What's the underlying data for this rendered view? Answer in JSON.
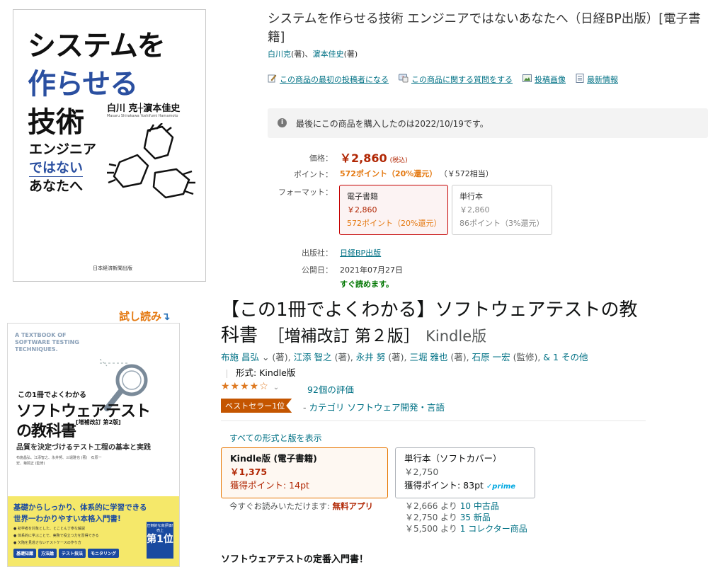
{
  "book1": {
    "cover": {
      "line1": "システムを",
      "line2a": "作らせる",
      "line3": "技術",
      "authors": "白川 克┼濵本佳史",
      "romaji": "Masaru Shirakawa    Yoshifumi Hamamoto",
      "sub1": "エンジニア",
      "sub2": "ではない",
      "sub3": "あなたへ",
      "publisher": "日本経済新聞出版"
    },
    "title": "システムを作らせる技術 エンジニアではないあなたへ（日経BP出版）[電子書籍]",
    "author1": "白川克",
    "author1_role": "(著)、",
    "author2": "濵本佳史",
    "author2_role": "(著)",
    "actions": [
      {
        "label": "この商品の最初の投稿者になる",
        "icon": "pencil-icon"
      },
      {
        "label": "この商品に関する質問をする",
        "icon": "question-icon"
      },
      {
        "label": "投稿画像",
        "icon": "image-icon"
      },
      {
        "label": "最新情報",
        "icon": "document-icon"
      }
    ],
    "notice": "最後にこの商品を購入したのは2022/10/19です。",
    "price_label": "価格：",
    "price": "￥2,860",
    "price_tax": "(税込)",
    "point_label": "ポイント：",
    "point_value": "572ポイント（20%還元）",
    "point_equiv": "（￥572相当）",
    "format_label": "フォーマット：",
    "formats": [
      {
        "name": "電子書籍",
        "price": "￥2,860",
        "points": "572ポイント（20%還元）"
      },
      {
        "name": "単行本",
        "price": "￥2,860",
        "points": "86ポイント（3%還元）"
      }
    ],
    "publisher_label": "出版社：",
    "publisher": "日経BP出版",
    "date_label": "公開日：",
    "date": "2021年07月27日",
    "readnow": "すぐ読めます。"
  },
  "book2": {
    "tachiyomi": "試し読み",
    "tachiyomi_arrow": "↴",
    "cover": {
      "eng": "A TEXTBOOK OF SOFTWARE TESTING TECHNIQUES.",
      "lead": "この1冊でよくわかる",
      "big1": "ソフトウェアテスト",
      "big2": "の教科書",
      "edition": "[増補改訂 第2版]",
      "sub": "品質を決定づけるテスト工程の基本と実践",
      "authors": "布施昌弘、江添智之、永井努、三堀雅也 (著)　石原一宏、菊岡正 (監修)",
      "h1": "基礎からしっかり、体系的に学習できる",
      "h2": "世界一わかりやすい本格入門書!",
      "bullets": [
        "● 初学者を対象とした、とことん丁寧な解説",
        "● 体系的に学ぶことで、実務で役立つ力を習得できる",
        "● 欠陥を見逃さないテストケースの作り方"
      ],
      "tags": [
        "基礎知識",
        "方法論",
        "テスト技法",
        "モニタリング"
      ],
      "rank_top": "圧倒的な高評価! 売上",
      "rank_big": "第1位"
    },
    "title_main": "【この1冊でよくわかる】ソフトウェアテストの教科書",
    "title_edition": "［増補改訂 第２版］",
    "title_format": "Kindle版",
    "authors": [
      {
        "name": "布施 昌弘",
        "role": " ⌄ (著), "
      },
      {
        "name": "江添 智之",
        "role": " (著), "
      },
      {
        "name": "永井 努",
        "role": " (著), "
      },
      {
        "name": "三堀 雅也",
        "role": " (著), "
      },
      {
        "name": "石原 一宏",
        "role": " (監修), "
      },
      {
        "name": "& 1 その他",
        "role": ""
      }
    ],
    "format_line": "形式: Kindle版",
    "stars": "★★★★☆",
    "rating_value": 4.1,
    "ratings_count": "92個の評価",
    "bestseller": "ベストセラー1位",
    "category_dash": "-",
    "category": "カテゴリ ソフトウェア開発・言語",
    "all_formats": "すべての形式と版を表示",
    "kindle": {
      "name": "Kindle版 (電子書籍)",
      "price": "￥1,375",
      "points": "獲得ポイント: 14pt"
    },
    "paper": {
      "name": "単行本（ソフトカバー）",
      "price": "￥2,750",
      "points": "獲得ポイント: 83pt",
      "prime": "✓prime"
    },
    "readnow_text": "今すぐお読みいただけます: ",
    "readnow_app": "無料アプリ",
    "used": [
      {
        "price": "￥2,666 より",
        "link": "10 中古品"
      },
      {
        "price": "￥2,750 より",
        "link": "35 新品"
      },
      {
        "price": "￥5,500 より",
        "link": "1 コレクター商品"
      }
    ],
    "desc": "ソフトウェアテストの定番入門書！"
  }
}
